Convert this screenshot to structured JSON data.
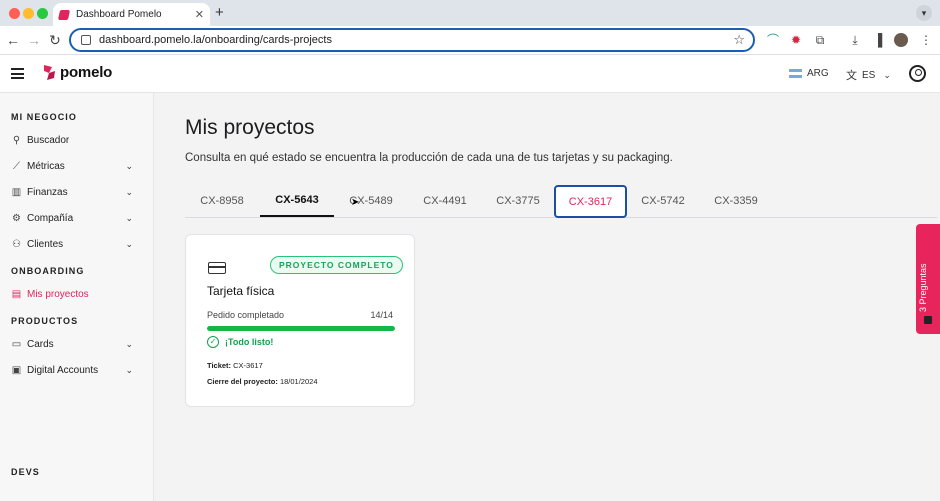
{
  "browser": {
    "tab_title": "Dashboard Pomelo",
    "tab_close": "✕",
    "new_tab": "+",
    "url": "dashboard.pomelo.la/onboarding/cards-projects"
  },
  "app": {
    "brand": "pomelo",
    "country": "ARG",
    "language": "ES"
  },
  "sidebar": {
    "section_business": "MI NEGOCIO",
    "items_business": [
      {
        "label": "Buscador",
        "icon": "search-icon"
      },
      {
        "label": "Métricas",
        "icon": "chart-icon"
      },
      {
        "label": "Finanzas",
        "icon": "building-icon"
      },
      {
        "label": "Compañía",
        "icon": "gear-icon"
      },
      {
        "label": "Clientes",
        "icon": "users-icon"
      }
    ],
    "section_onboarding": "ONBOARDING",
    "item_projects": "Mis proyectos",
    "section_products": "PRODUCTOS",
    "items_products": [
      {
        "label": "Cards",
        "icon": "card-icon"
      },
      {
        "label": "Digital Accounts",
        "icon": "wallet-icon"
      }
    ],
    "section_devs": "DEVS"
  },
  "main": {
    "title": "Mis proyectos",
    "subtitle": "Consulta en qué estado se encuentra la producción de cada una de tus tarjetas y su packaging.",
    "tabs": [
      "CX-8958",
      "CX-5643",
      "CX-5489",
      "CX-4491",
      "CX-3775",
      "CX-3617",
      "CX-5742",
      "CX-3359"
    ],
    "hovered_tab": "CX-5643",
    "selected_tab": "CX-3617",
    "card": {
      "badge": "PROYECTO COMPLETO",
      "title": "Tarjeta física",
      "progress_label": "Pedido completado",
      "progress_count": "14/14",
      "progress_fraction": 1.0,
      "status": "¡Todo listo!",
      "ticket_label": "Ticket:",
      "ticket_value": "CX-3617",
      "closure_label": "Cierre del proyecto:",
      "closure_value": "18/01/2024"
    }
  },
  "help_widget": {
    "label": "3 Preguntas"
  },
  "colors": {
    "accent": "#e0245e",
    "success": "#16b548",
    "focus": "#1a4fa3"
  }
}
